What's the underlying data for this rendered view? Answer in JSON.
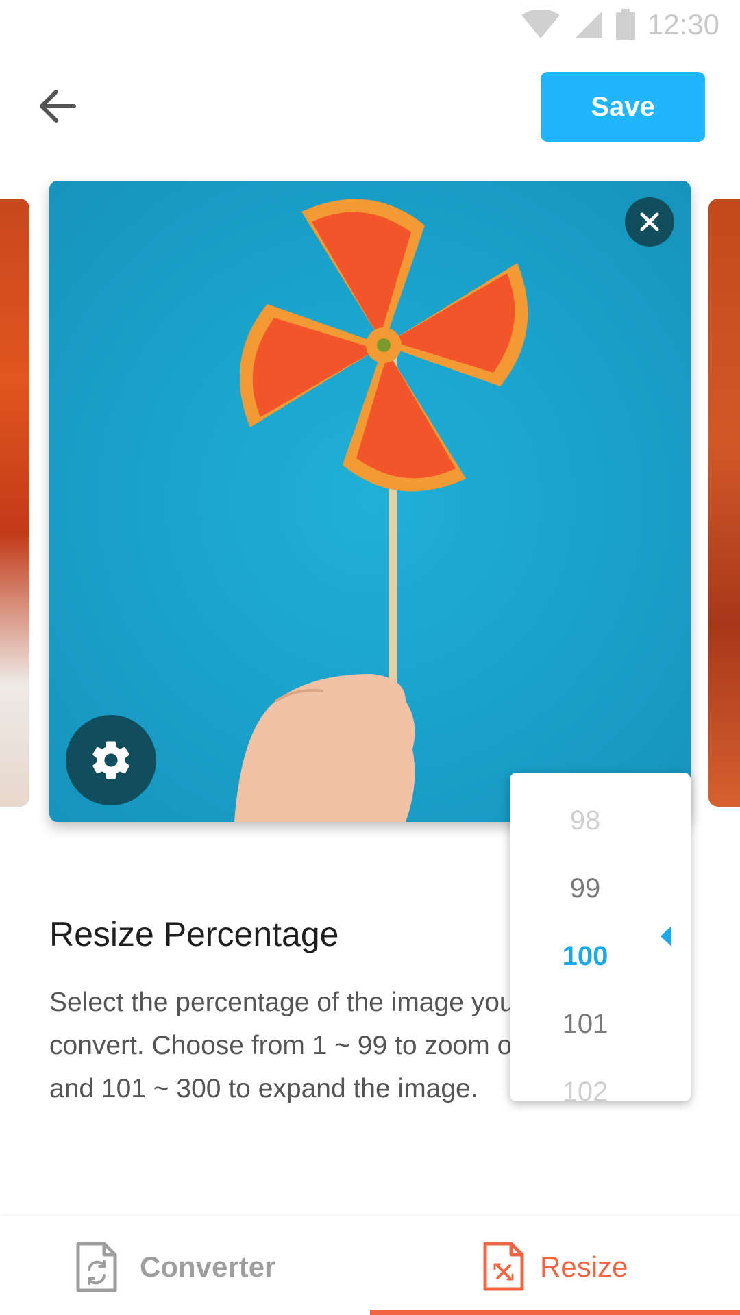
{
  "status_bar": {
    "time": "12:30",
    "icons": [
      "wifi-icon",
      "signal-icon",
      "battery-icon"
    ]
  },
  "header": {
    "back_icon": "arrow-left-icon",
    "save_label": "Save"
  },
  "preview": {
    "close_icon": "close-icon",
    "settings_icon": "gear-icon"
  },
  "picker": {
    "values": [
      "98",
      "99",
      "100",
      "101",
      "102"
    ],
    "selected": "100",
    "selected_marker_icon": "caret-left-icon"
  },
  "resize_section": {
    "title": "Resize Percentage",
    "description": "Select the percentage of the image you want to convert. Choose from 1 ~ 99 to zoom out the image and 101 ~ 300 to expand the image."
  },
  "bottom_nav": {
    "tabs": [
      {
        "label": "Converter",
        "icon": "file-convert-icon",
        "active": false
      },
      {
        "label": "Resize",
        "icon": "file-resize-icon",
        "active": true
      }
    ]
  },
  "colors": {
    "accent_blue": "#1fb6ff",
    "accent_orange": "#f26544",
    "dark_teal": "#114e5d",
    "photo_background": "#1aa3cc"
  }
}
